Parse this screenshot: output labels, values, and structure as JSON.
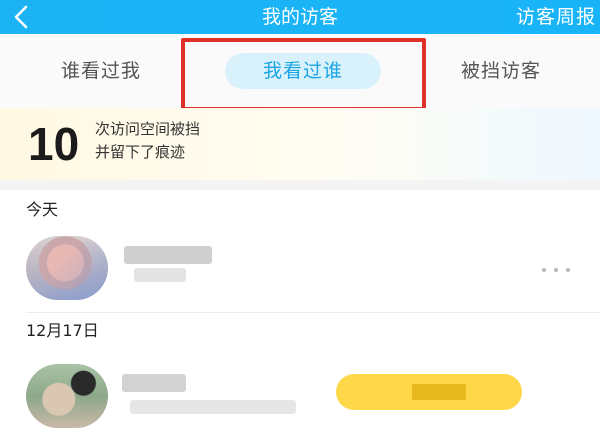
{
  "header": {
    "back_icon": "chevron-left-icon",
    "title": "我的访客",
    "weekly_report": "访客周报"
  },
  "tabs": [
    {
      "label": "谁看过我",
      "active": false
    },
    {
      "label": "我看过谁",
      "active": true
    },
    {
      "label": "被挡访客",
      "active": false
    }
  ],
  "summary": {
    "count": "10",
    "line1": "次访问空间被挡",
    "line2": "并留下了痕迹"
  },
  "sections": [
    {
      "title": "今天"
    },
    {
      "title": "12月17日"
    }
  ],
  "colors": {
    "header": "#1cb3f5",
    "active_tab_text": "#1aa5e6",
    "active_tab_bg": "#d9f1fb",
    "highlight_border": "#e0302a",
    "badge": "#ffd84a"
  }
}
